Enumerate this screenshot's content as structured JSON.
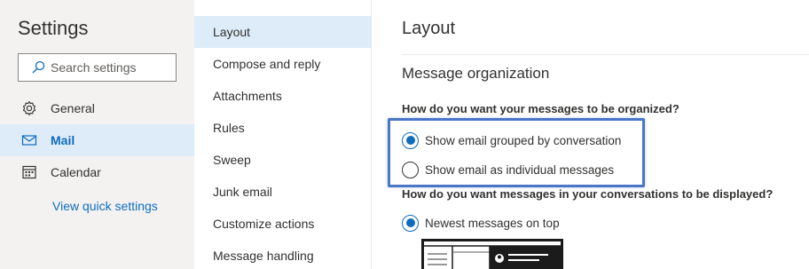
{
  "settings": {
    "title": "Settings",
    "search_placeholder": "Search settings",
    "nav": [
      {
        "label": "General",
        "icon": "gear-icon"
      },
      {
        "label": "Mail",
        "icon": "mail-icon"
      },
      {
        "label": "Calendar",
        "icon": "calendar-icon"
      }
    ],
    "selected_nav": "Mail",
    "quick_settings_link": "View quick settings"
  },
  "subnav": {
    "items": [
      "Layout",
      "Compose and reply",
      "Attachments",
      "Rules",
      "Sweep",
      "Junk email",
      "Customize actions",
      "Message handling"
    ],
    "selected": "Layout"
  },
  "content": {
    "title": "Layout",
    "section_title": "Message organization",
    "question1": "How do you want your messages to be organized?",
    "option_grouped": "Show email grouped by conversation",
    "option_individual": "Show email as individual messages",
    "option_grouped_checked": true,
    "question2": "How do you want messages in your conversations to be displayed?",
    "option_newest": "Newest messages on top",
    "option_newest_checked": true
  },
  "colors": {
    "accent": "#0f6cbd",
    "selected_bg": "#deecf9",
    "left_bg": "#f3f2f1",
    "highlight_border": "#4a76c7",
    "link": "#106ebe"
  }
}
